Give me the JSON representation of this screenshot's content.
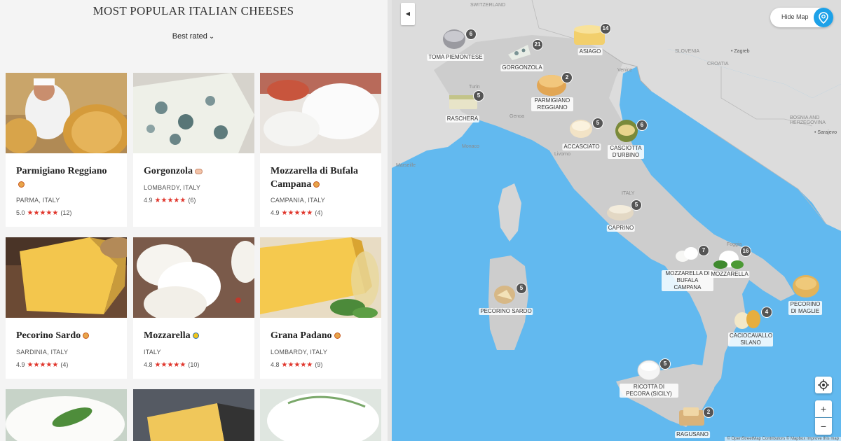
{
  "header": {
    "title": "MOST POPULAR ITALIAN CHEESES",
    "sort_label": "Best rated"
  },
  "cards": [
    {
      "name": "Parmigiano Reggiano",
      "location": "PARMA, ITALY",
      "rating": "5.0",
      "stars": "★★★★★",
      "reviews": "(12)",
      "badge": "orange",
      "photo": "parmigiano-photo"
    },
    {
      "name": "Gorgonzola",
      "location": "LOMBARDY, ITALY",
      "rating": "4.9",
      "stars": "★★★★★",
      "reviews": "(6)",
      "badge": "pink",
      "photo": "gorgonzola-photo"
    },
    {
      "name": "Mozzarella di Bufala Campana",
      "location": "CAMPANIA, ITALY",
      "rating": "4.9",
      "stars": "★★★★★",
      "reviews": "(4)",
      "badge": "orange",
      "photo": "mozzarella-bufala-photo"
    },
    {
      "name": "Pecorino Sardo",
      "location": "SARDINIA, ITALY",
      "rating": "4.9",
      "stars": "★★★★★",
      "reviews": "(4)",
      "badge": "orange",
      "photo": "pecorino-sardo-photo"
    },
    {
      "name": "Mozzarella",
      "location": "ITALY",
      "rating": "4.8",
      "stars": "★★★★★",
      "reviews": "(10)",
      "badge": "blue",
      "photo": "mozzarella-photo"
    },
    {
      "name": "Grana Padano",
      "location": "LOMBARDY, ITALY",
      "rating": "4.8",
      "stars": "★★★★★",
      "reviews": "(9)",
      "badge": "orange",
      "photo": "grana-padano-photo"
    }
  ],
  "map": {
    "hide_map_label": "Hide Map",
    "attribution": "© OpenStreetMap Contributors © Mapbox Improve this map",
    "zoom_in": "+",
    "zoom_out": "−",
    "places": {
      "switzerland": "SWITZERLAND",
      "slovenia": "SLOVENIA",
      "zagreb": "• Zagreb",
      "croatia": "CROATIA",
      "sarajevo": "• Sarajevo",
      "bosnia": "BOSNIA AND HERZEGOVINA",
      "monaco": "Monaco",
      "marseille": "Marseille",
      "turin": "Turin",
      "genoa": "Genoa",
      "venice": "Venice",
      "livorno": "Livorno",
      "italy": "ITALY",
      "foggia": "Foggia"
    },
    "markers": [
      {
        "label": "TOMA PIEMONTESE",
        "count": "6"
      },
      {
        "label": "GORGONZOLA",
        "count": "21"
      },
      {
        "label": "ASIAGO",
        "count": "14"
      },
      {
        "label": "PARMIGIANO REGGIANO",
        "count": "2"
      },
      {
        "label": "RASCHERA",
        "count": "5"
      },
      {
        "label": "ACCASCIATO",
        "count": "5"
      },
      {
        "label": "CASCIOTTA D'URBINO",
        "count": "6"
      },
      {
        "label": "CAPRINO",
        "count": "5"
      },
      {
        "label": "MOZZARELLA DI BUFALA CAMPANA",
        "count": "7"
      },
      {
        "label": "MOZZARELLA",
        "count": "16"
      },
      {
        "label": "PECORINO SARDO",
        "count": "5"
      },
      {
        "label": "PECORINO DI MAGLIE",
        "count": ""
      },
      {
        "label": "CACIOCAVALLO SILANO",
        "count": "4"
      },
      {
        "label": "RICOTTA DI PECORA (SICILY)",
        "count": "5"
      },
      {
        "label": "RAGUSANO",
        "count": "2"
      }
    ]
  },
  "colors": {
    "sea": "#62b9ef",
    "land": "#d9d9d9",
    "italy": "#c9c9c9",
    "star": "#e0352b",
    "accent": "#1da1e8"
  }
}
